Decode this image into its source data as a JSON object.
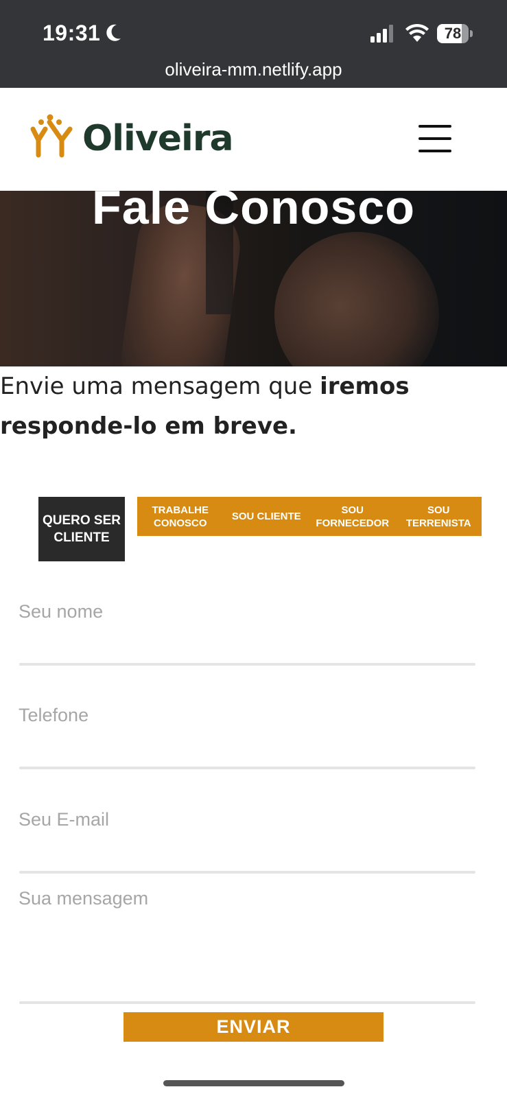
{
  "status_bar": {
    "time": "19:31",
    "battery": "78",
    "battery_level": 0.78,
    "url": "oliveira-mm.netlify.app",
    "icons": [
      "moon-icon",
      "cellular-signal-icon",
      "wifi-icon",
      "battery-icon"
    ]
  },
  "header": {
    "logo_text": "Oliveira",
    "menu_icon": "hamburger-menu-icon",
    "colors": {
      "logo_mark": "#d78b12",
      "logo_text": "#1f3a2c"
    }
  },
  "hero": {
    "title": "Fale Conosco"
  },
  "intro": {
    "text_regular": "Envie uma mensagem que ",
    "text_bold": "iremos responde-lo em breve."
  },
  "tabs": {
    "active": "QUERO SER CLIENTE",
    "items": [
      "TRABALHE CONOSCO",
      "SOU CLIENTE",
      "SOU FORNECEDOR",
      "SOU TERRENISTA"
    ],
    "colors": {
      "active_bg": "#2a2a2a",
      "tab_bg": "#d78b12"
    }
  },
  "form": {
    "name_placeholder": "Seu nome",
    "phone_placeholder": "Telefone",
    "email_placeholder": "Seu E-mail",
    "message_placeholder": "Sua mensagem",
    "submit_label": "ENVIAR"
  }
}
